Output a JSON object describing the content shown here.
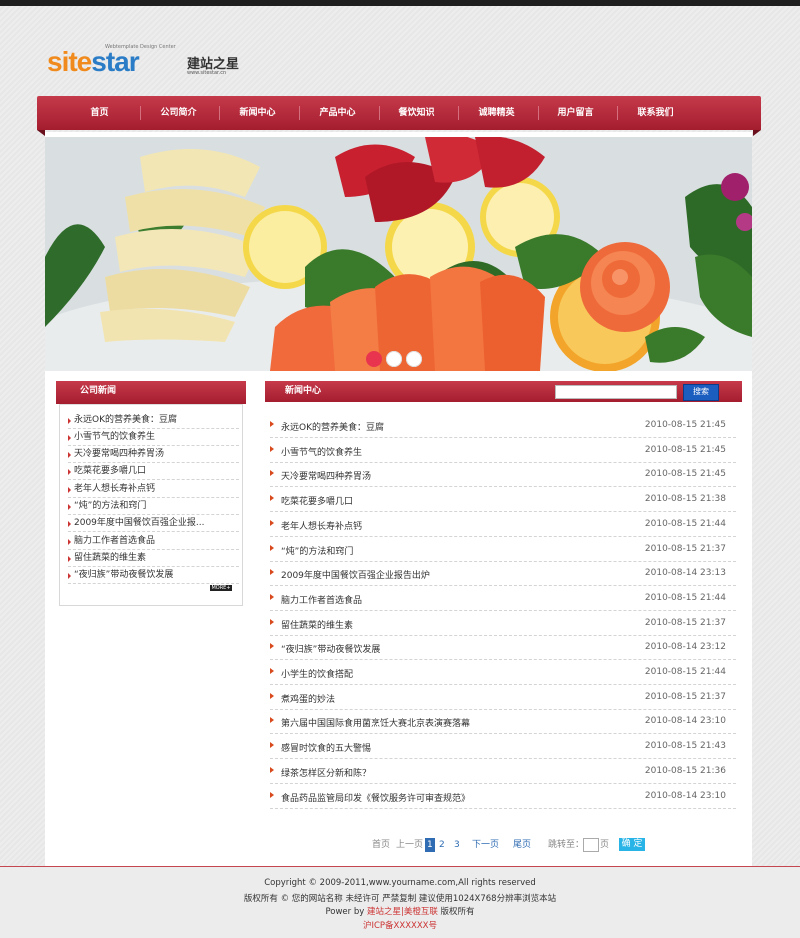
{
  "brand": {
    "logo_prefix": "site",
    "logo_suffix": "star",
    "logo_tagline": "Webtemplate Design Center",
    "logo_cn": "建站之星",
    "logo_url": "www.sitestar.cn"
  },
  "nav": [
    "首页",
    "公司简介",
    "新闻中心",
    "产品中心",
    "餐饮知识",
    "诚聘精英",
    "用户留言",
    "联系我们"
  ],
  "banner": {
    "active_dot": 0,
    "dot_colors": [
      "#e8344f",
      "#ffffff",
      "#ffffff"
    ]
  },
  "left_news": {
    "title": "公司新闻",
    "items": [
      "永远OK的营养美食：豆腐",
      "小雪节气的饮食养生",
      "天冷要常喝四种养胃汤",
      "吃菜花要多嚼几口",
      "老年人想长寿补点钙",
      "“炖”的方法和窍门",
      "2009年度中国餐饮百强企业报...",
      "脑力工作者首选食品",
      "留住蔬菜的维生素",
      "“夜归族”带动夜餐饮发展"
    ],
    "more_label": "MORE+"
  },
  "news_center": {
    "title": "新闻中心",
    "search_placeholder": "",
    "search_button": "搜索",
    "rows": [
      {
        "title": "永远OK的营养美食：豆腐",
        "date": "2010-08-15 21:45"
      },
      {
        "title": "小雪节气的饮食养生",
        "date": "2010-08-15 21:45"
      },
      {
        "title": "天冷要常喝四种养胃汤",
        "date": "2010-08-15 21:45"
      },
      {
        "title": "吃菜花要多嚼几口",
        "date": "2010-08-15 21:38"
      },
      {
        "title": "老年人想长寿补点钙",
        "date": "2010-08-15 21:44"
      },
      {
        "title": "“炖”的方法和窍门",
        "date": "2010-08-15 21:37"
      },
      {
        "title": "2009年度中国餐饮百强企业报告出炉",
        "date": "2010-08-14 23:13"
      },
      {
        "title": "脑力工作者首选食品",
        "date": "2010-08-15 21:44"
      },
      {
        "title": "留住蔬菜的维生素",
        "date": "2010-08-15 21:37"
      },
      {
        "title": "“夜归族”带动夜餐饮发展",
        "date": "2010-08-14 23:12"
      },
      {
        "title": "小学生的饮食搭配",
        "date": "2010-08-15 21:44"
      },
      {
        "title": "煮鸡蛋的妙法",
        "date": "2010-08-15 21:37"
      },
      {
        "title": "第六届中国国际食用菌烹饪大赛北京表演赛落幕",
        "date": "2010-08-14 23:10"
      },
      {
        "title": "感冒时饮食的五大警惕",
        "date": "2010-08-15 21:43"
      },
      {
        "title": "绿茶怎样区分新和陈？",
        "date": "2010-08-15 21:36"
      },
      {
        "title": "食品药品监管局印发《餐饮服务许可审查规范》",
        "date": "2010-08-14 23:10"
      }
    ]
  },
  "pager": {
    "first": "首页",
    "prev": "上一页",
    "pages": [
      "1",
      "2",
      "3"
    ],
    "current_page": "1",
    "next": "下一页",
    "last": "尾页",
    "jump_label": "跳转至：",
    "page_unit": "页",
    "go": "确 定"
  },
  "footer": {
    "copyright": "Copyright © 2009-2011,www.yourname.com,All rights reserved",
    "line2": "版权所有 © 您的网站名称 未经许可 严禁复制 建议使用1024X768分辨率浏览本站",
    "power_prefix": "Power by",
    "power_link": "建站之星|美橙互联",
    "power_suffix": "版权所有",
    "icp": "沪ICP备XXXXXX号"
  },
  "colors": {
    "brand_red": "#b12a3b",
    "logo_orange": "#f08a1c",
    "logo_blue": "#2a7cc7",
    "link_blue": "#2f6cb3"
  }
}
